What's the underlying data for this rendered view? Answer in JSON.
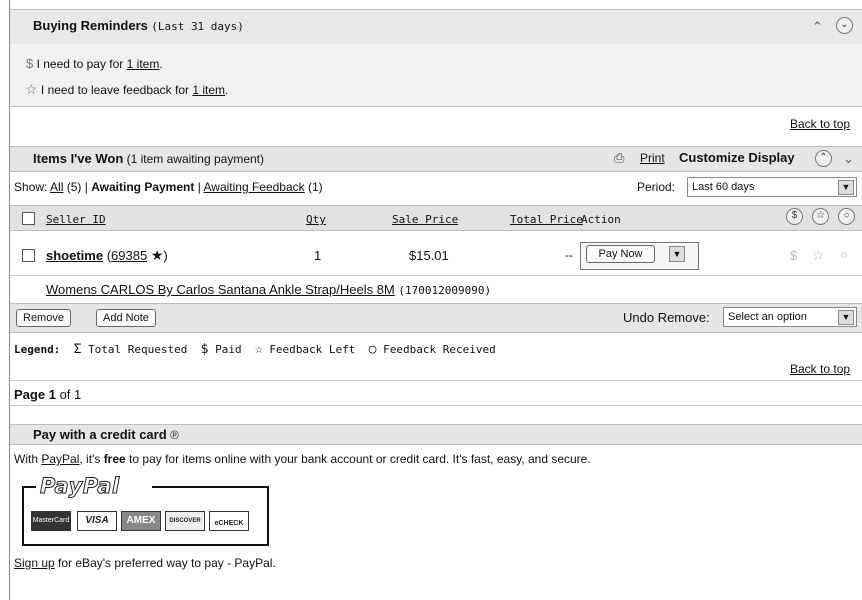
{
  "buying_reminders": {
    "title": "Buying Reminders",
    "period": "(Last 31 days)",
    "pay_prefix": "I need to pay for",
    "pay_link": "1 item",
    "pay_suffix": ".",
    "feedback_prefix": "I need to leave feedback for",
    "feedback_link": "1 item",
    "feedback_suffix": "."
  },
  "back_to_top": "Back to top",
  "items_won": {
    "title": "Items I've Won",
    "subtitle": "(1 item awaiting payment)",
    "print_label": "Print",
    "customize_label": "Customize Display"
  },
  "filter": {
    "show_label": "Show:",
    "all_link": "All",
    "all_count": "(5)",
    "sep": "|",
    "awaiting_payment": "Awaiting Payment",
    "awaiting_feedback_link": "Awaiting Feedback",
    "awaiting_feedback_count": "(1)",
    "period_label": "Period:",
    "period_value": "Last 60 days"
  },
  "table": {
    "headers": {
      "seller_id": "Seller ID",
      "qty": "Qty",
      "sale_price": "Sale Price",
      "total_price": "Total Price",
      "action": "Action"
    },
    "rows": [
      {
        "seller": "shoetime",
        "feedback_score": "69385",
        "close_paren": ")",
        "qty": "1",
        "sale_price": "$15.01",
        "total_price": "--",
        "action_button": "Pay Now",
        "item_title": "Womens CARLOS By Carlos Santana Ankle Strap/Heels 8M",
        "item_number": "(170012009090)"
      }
    ]
  },
  "actions": {
    "remove": "Remove",
    "add_note": "Add Note",
    "undo_label": "Undo Remove:",
    "undo_value": "Select an option"
  },
  "legend": {
    "label": "Legend:",
    "total_requested": "Total Requested",
    "paid": "Paid",
    "feedback_left": "Feedback Left",
    "feedback_received": "Feedback Received"
  },
  "pagination": {
    "page_word": "Page",
    "current": "1",
    "of_text": "of 1"
  },
  "paypal_section": {
    "title": "Pay with a credit card",
    "text_prefix": "With",
    "paypal_link": "PayPal",
    "text_mid": ", it's",
    "text_bold": "free",
    "text_rest": "to pay for items online with your bank account or credit card. It's fast, easy, and secure.",
    "logo_text": "PayPal",
    "cards": [
      "MasterCard",
      "VISA",
      "AMEX",
      "DISCOVER",
      "eCHECK"
    ],
    "signup_link": "Sign up",
    "signup_rest": "for eBay's preferred way to pay - PayPal."
  }
}
